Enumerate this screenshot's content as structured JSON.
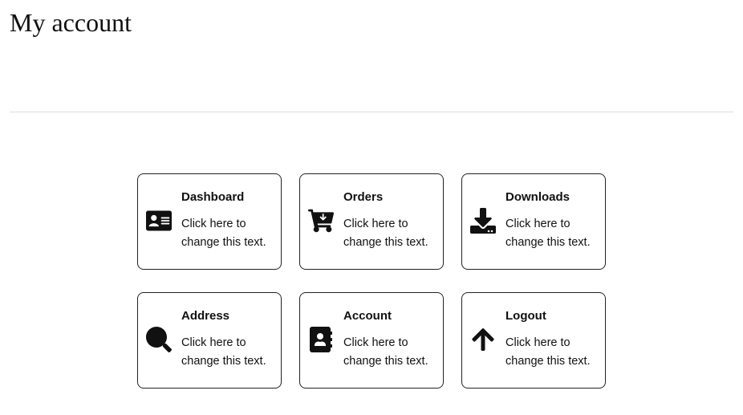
{
  "page": {
    "title": "My account"
  },
  "cards": [
    {
      "title": "Dashboard",
      "desc": "Click here to change this text."
    },
    {
      "title": "Orders",
      "desc": "Click here to change this text."
    },
    {
      "title": "Downloads",
      "desc": "Click here to change this text."
    },
    {
      "title": "Address",
      "desc": "Click here to change this text."
    },
    {
      "title": "Account",
      "desc": "Click here to change this text."
    },
    {
      "title": "Logout",
      "desc": "Click here to change this text."
    }
  ]
}
